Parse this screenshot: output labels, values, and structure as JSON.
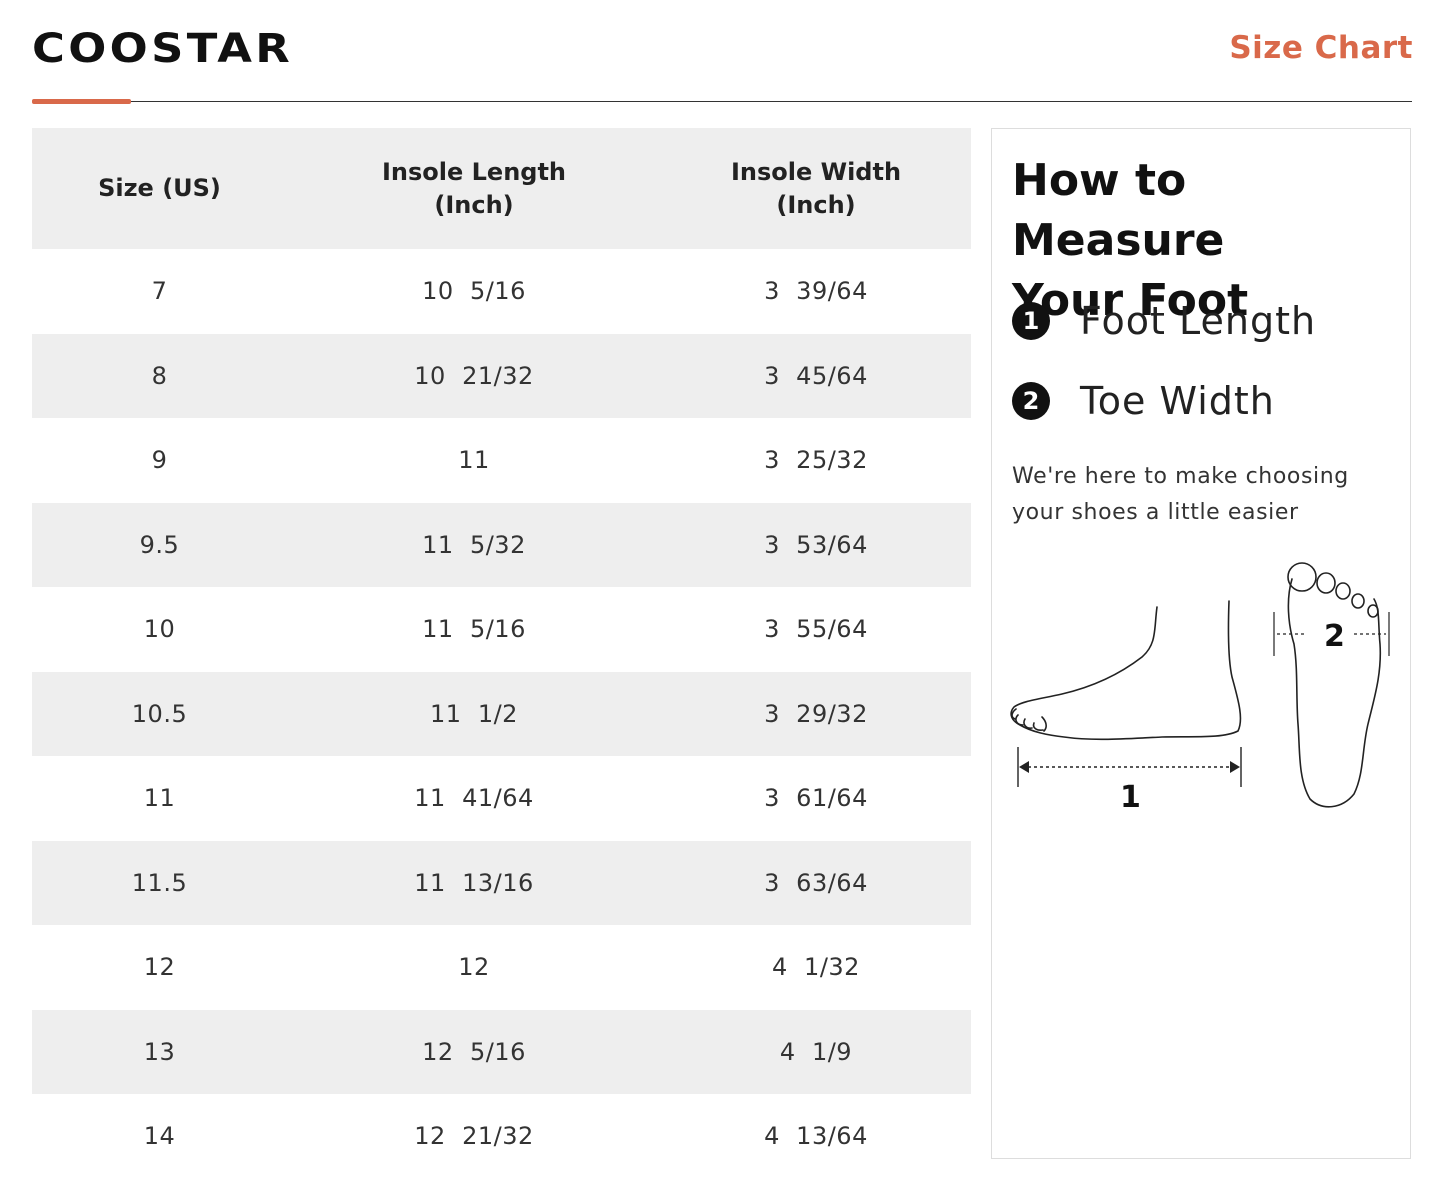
{
  "header": {
    "brand": "COOSTAR",
    "title": "Size Chart",
    "accent_color": "#d9694a"
  },
  "table": {
    "columns": [
      "Size (US)",
      "Insole Length\n(Inch)",
      "Insole Width\n(Inch)"
    ],
    "rows": [
      [
        "7",
        "10  5/16",
        "3  39/64"
      ],
      [
        "8",
        "10  21/32",
        "3  45/64"
      ],
      [
        "9",
        "11",
        "3  25/32"
      ],
      [
        "9.5",
        "11  5/32",
        "3  53/64"
      ],
      [
        "10",
        "11  5/16",
        "3  55/64"
      ],
      [
        "10.5",
        "11  1/2",
        "3  29/32"
      ],
      [
        "11",
        "11  41/64",
        "3  61/64"
      ],
      [
        "11.5",
        "11  13/16",
        "3  63/64"
      ],
      [
        "12",
        "12",
        "4  1/32"
      ],
      [
        "13",
        "12  5/16",
        "4  1/9"
      ],
      [
        "14",
        "12  21/32",
        "4  13/64"
      ]
    ]
  },
  "panel": {
    "title": "How to Measure\nYour Foot",
    "steps": [
      {
        "number": "1",
        "label": "Foot Length"
      },
      {
        "number": "2",
        "label": "Toe Width"
      }
    ],
    "note": "We're here to make choosing your shoes a little easier",
    "diagram_labels": {
      "length": "1",
      "width": "2"
    },
    "icons": [
      "foot-side-view-icon",
      "foot-sole-view-icon"
    ]
  }
}
